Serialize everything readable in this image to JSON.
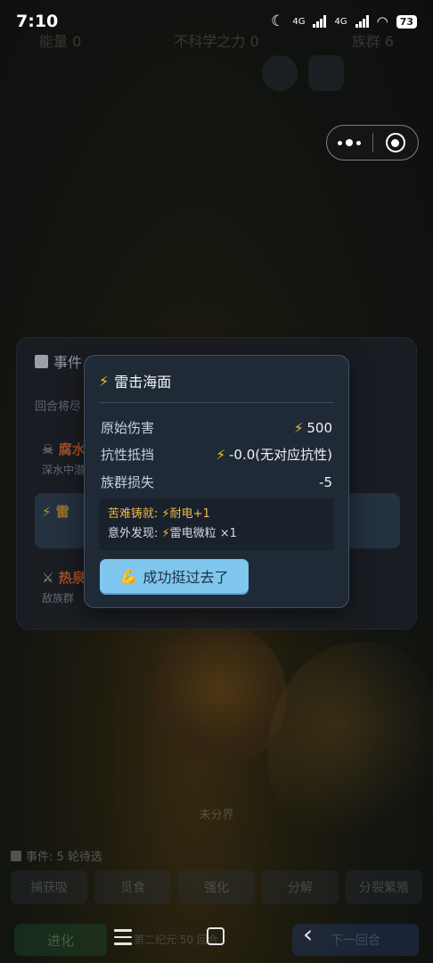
{
  "status_bar": {
    "time": "7:10",
    "network_1": "4G",
    "network_2": "4G",
    "battery": "73"
  },
  "game_header": {
    "energy": "能量 0",
    "power": "不科学之力 0",
    "population": "族群 6"
  },
  "event_panel": {
    "title": "事件",
    "subtitle": "回合将尽",
    "items": [
      {
        "title": "腐水",
        "desc": "深水中潜"
      },
      {
        "title": "雷",
        "desc": ""
      },
      {
        "title": "热泉",
        "desc": "敌族群"
      }
    ]
  },
  "popup": {
    "icon": "⚡",
    "title": "雷击海面",
    "rows": [
      {
        "label": "原始伤害",
        "icon": "⚡",
        "value": "500"
      },
      {
        "label": "抗性抵挡",
        "icon": "⚡",
        "value": "-0.0(无对应抗性)"
      },
      {
        "label": "族群损失",
        "icon": "",
        "value": "-5"
      }
    ],
    "note_hardship_label": "苦难铸就: ",
    "note_hardship_icon": "⚡",
    "note_hardship_value": "耐电+1",
    "note_found_label": "意外发现: ",
    "note_found_icon": "⚡",
    "note_found_value": "雷电微粒 ×1",
    "confirm_icon": "💪",
    "confirm_label": "成功挺过去了"
  },
  "game_footer": {
    "bottom_label": "未分界",
    "pending": "事件: 5 轮待选",
    "actions": [
      "捕获吸",
      "觅食",
      "强化",
      "分解",
      "分裂繁殖"
    ],
    "evolve": "进化",
    "round_info": "第二纪元 50 回合",
    "next": "下一回合"
  },
  "colors": {
    "accent_bolt": "#f3c327",
    "confirm_button": "#7fc7ee",
    "popup_background": "#1f2a36",
    "hardship_text": "#f0b94a"
  }
}
